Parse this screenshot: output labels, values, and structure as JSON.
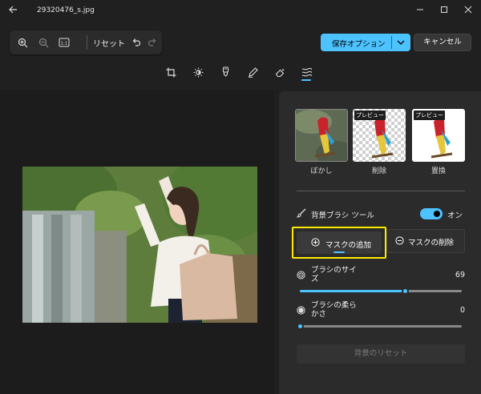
{
  "window": {
    "filename": "29320476_s.jpg",
    "back_icon": "back-arrow-icon",
    "controls": [
      "minimize-icon",
      "maximize-icon",
      "close-icon"
    ]
  },
  "toolbar": {
    "zoom_in_icon": "zoom-in-icon",
    "zoom_out_icon": "zoom-out-icon",
    "fit_icon": "actual-size-icon",
    "fit_label": "1:1",
    "reset_label": "リセット",
    "undo_icon": "undo-icon",
    "redo_icon": "redo-icon",
    "save_label": "保存オプション",
    "cancel_label": "キャンセル"
  },
  "tabs": [
    {
      "icon": "crop-icon"
    },
    {
      "icon": "adjust-brightness-icon"
    },
    {
      "icon": "filter-icon"
    },
    {
      "icon": "markup-pen-icon"
    },
    {
      "icon": "erase-icon"
    },
    {
      "icon": "background-icon",
      "active": true
    }
  ],
  "background_panel": {
    "options": [
      {
        "label": "ぼかし",
        "badge": "",
        "selected": true
      },
      {
        "label": "削除",
        "badge": "プレビュー",
        "selected": false
      },
      {
        "label": "置換",
        "badge": "プレビュー",
        "selected": false
      }
    ],
    "brush_tool_label": "背景ブラシ ツール",
    "brush_tool_state": "オン",
    "mask_add_label": "マスクの追加",
    "mask_remove_label": "マスクの削除",
    "brush_size_label": "ブラシのサイズ",
    "brush_size_value": "69",
    "brush_size_fraction": 0.65,
    "brush_softness_label": "ブラシの柔らかさ",
    "brush_softness_value": "0",
    "brush_softness_fraction": 0.0,
    "reset_bg_label": "背景のリセット"
  },
  "colors": {
    "accent": "#4cc2ff",
    "highlight_box": "#ffeb00",
    "background": "#202020",
    "panel": "#2b2b2b"
  }
}
